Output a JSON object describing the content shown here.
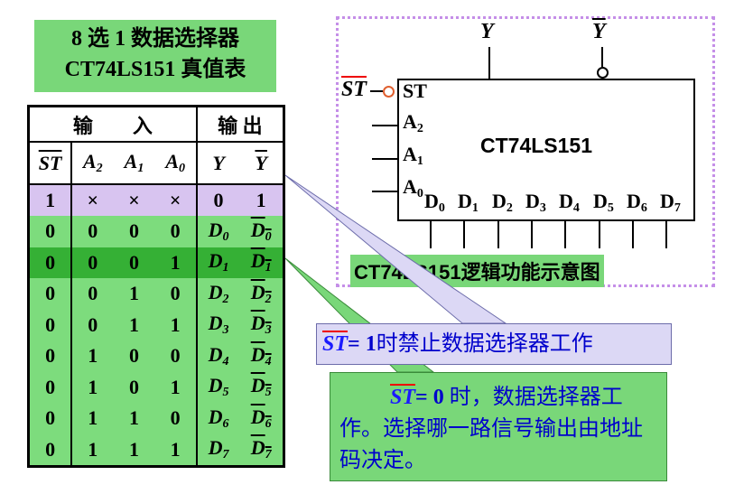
{
  "title": {
    "line1": "8 选 1 数据选择器",
    "line2": "CT74LS151 真值表"
  },
  "table": {
    "group_input": "输　　入",
    "group_output": "输 出",
    "columns": [
      "ST",
      "A2",
      "A1",
      "A0",
      "Y",
      "Y"
    ],
    "rows": [
      [
        "1",
        "×",
        "×",
        "×",
        "0",
        "1"
      ],
      [
        "0",
        "0",
        "0",
        "0",
        "D0",
        "D0"
      ],
      [
        "0",
        "0",
        "0",
        "1",
        "D1",
        "D1"
      ],
      [
        "0",
        "0",
        "1",
        "0",
        "D2",
        "D2"
      ],
      [
        "0",
        "0",
        "1",
        "1",
        "D3",
        "D3"
      ],
      [
        "0",
        "1",
        "0",
        "0",
        "D4",
        "D4"
      ],
      [
        "0",
        "1",
        "0",
        "1",
        "D5",
        "D5"
      ],
      [
        "0",
        "1",
        "1",
        "0",
        "D6",
        "D6"
      ],
      [
        "0",
        "1",
        "1",
        "1",
        "D7",
        "D7"
      ]
    ]
  },
  "diagram": {
    "chip_name": "CT74LS151",
    "st_label": "ST",
    "pin_st": "ST",
    "pin_a2": "A2",
    "pin_a1": "A1",
    "pin_a0": "A0",
    "data_pins": [
      "D0",
      "D1",
      "D2",
      "D3",
      "D4",
      "D5",
      "D6",
      "D7"
    ],
    "out_y": "Y",
    "out_ybar": "Y",
    "caption": "CT74LS151逻辑功能示意图"
  },
  "callout_disable": {
    "st": "ST",
    "eq": "= 1",
    "text": "时禁止数据选择器工作"
  },
  "callout_enable": {
    "st": "ST",
    "eq": "= 0",
    "text": " 时，数据选择器工作。选择哪一路信号输出由地址码决定。"
  },
  "colors": {
    "green": "#7ddc7d",
    "highlight_green": "#35b035",
    "purple_row": "#d8c4f0",
    "callout_purple": "#dcd8f5",
    "frame_dots": "#c58fe8"
  }
}
